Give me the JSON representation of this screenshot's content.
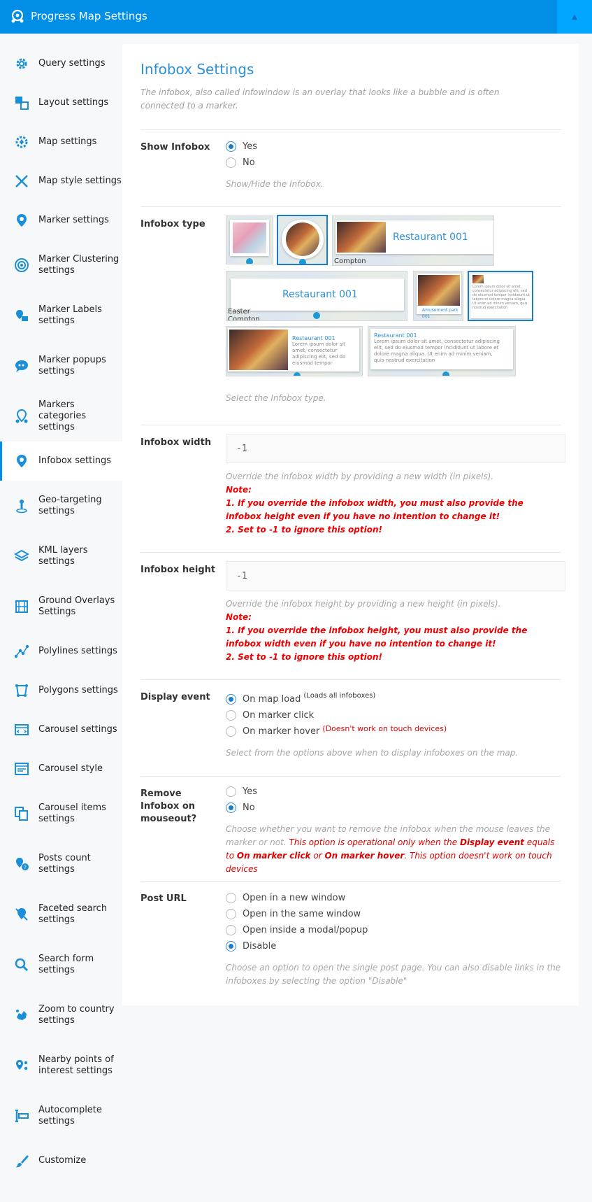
{
  "header": {
    "title": "Progress Map Settings",
    "collapse_icon": "▲"
  },
  "sidebar": {
    "items": [
      {
        "label": "Query settings",
        "icon": "gear-icon"
      },
      {
        "label": "Layout settings",
        "icon": "layout-icon"
      },
      {
        "label": "Map settings",
        "icon": "map-gear-icon"
      },
      {
        "label": "Map style settings",
        "icon": "brush-icon"
      },
      {
        "label": "Marker settings",
        "icon": "marker-icon"
      },
      {
        "label": "Marker Clustering settings",
        "icon": "cluster-icon"
      },
      {
        "label": "Marker Labels settings",
        "icon": "marker-label-icon"
      },
      {
        "label": "Marker popups settings",
        "icon": "popup-icon"
      },
      {
        "label": "Markers categories settings",
        "icon": "categories-icon"
      },
      {
        "label": "Infobox settings",
        "icon": "infobox-icon"
      },
      {
        "label": "Geo-targeting settings",
        "icon": "geo-target-icon"
      },
      {
        "label": "KML layers settings",
        "icon": "layers-icon"
      },
      {
        "label": "Ground Overlays Settings",
        "icon": "overlay-icon"
      },
      {
        "label": "Polylines settings",
        "icon": "polyline-icon"
      },
      {
        "label": "Polygons settings",
        "icon": "polygon-icon"
      },
      {
        "label": "Carousel settings",
        "icon": "carousel-icon"
      },
      {
        "label": "Carousel style",
        "icon": "carousel-style-icon"
      },
      {
        "label": "Carousel items settings",
        "icon": "carousel-items-icon"
      },
      {
        "label": "Posts count settings",
        "icon": "posts-count-icon"
      },
      {
        "label": "Faceted search settings",
        "icon": "faceted-search-icon"
      },
      {
        "label": "Search form settings",
        "icon": "search-icon"
      },
      {
        "label": "Zoom to country settings",
        "icon": "globe-icon"
      },
      {
        "label": "Nearby points of interest settings",
        "icon": "nearby-icon"
      },
      {
        "label": "Autocomplete settings",
        "icon": "autocomplete-icon"
      },
      {
        "label": "Customize",
        "icon": "customize-icon"
      }
    ]
  },
  "main": {
    "title": "Infobox Settings",
    "intro": "The infobox, also called infowindow is an overlay that looks like a bubble and is often connected to a marker.",
    "show_infobox": {
      "label": "Show Infobox",
      "options": [
        "Yes",
        "No"
      ],
      "selected": "Yes",
      "help": "Show/Hide the Infobox."
    },
    "infobox_type": {
      "label": "Infobox type",
      "thumb_title": "Restaurant 001",
      "thumb_small_title": "Restaurant 001",
      "thumb_town": "Compton",
      "thumb_town2": "Easter\nCompton",
      "thumb_park": "Amusement park 001",
      "thumb_lorem": "Lorem ipsum dolor sit amet, consectetur adipiscing elit, sed do eiusmod tempor incididunt",
      "thumb_lorem2": "Lorem ipsum dolor sit amet, consectetur adipiscing elit, sed do eiusmod tempor incididunt ut labore et dolore magna aliqua. Ut enim ad minim veniam, quis nostrud exercitation",
      "help": "Select the Infobox type."
    },
    "infobox_width": {
      "label": "Infobox width",
      "value": "-1",
      "help": "Override the infobox width by providing a new width (in pixels).",
      "note_title": "Note:",
      "note1": "1. If you override the infobox width, you must also provide the infobox height even if you have no intention to change it!",
      "note2": "2. Set to -1 to ignore this option!"
    },
    "infobox_height": {
      "label": "Infobox height",
      "value": "-1",
      "help": "Override the infobox height by providing a new height (in pixels).",
      "note_title": "Note:",
      "note1": "1. If you override the infobox height, you must also provide the infobox width even if you have no intention to change it!",
      "note2": "2. Set to -1 to ignore this option!"
    },
    "display_event": {
      "label": "Display event",
      "options": [
        "On map load",
        "On marker click",
        "On marker hover"
      ],
      "option1_sup": "(Loads all infoboxes)",
      "option3_warn": "(Doesn't work on touch devices)",
      "selected": "On map load",
      "help": "Select from the options above when to display infoboxes on the map."
    },
    "remove_infobox": {
      "label": "Remove Infobox on mouseout?",
      "options": [
        "Yes",
        "No"
      ],
      "selected": "No",
      "help_a": "Choose whether you want to remove the infobox when the mouse leaves the marker or not. ",
      "help_b": "This option is operational only when the ",
      "help_c": "Display event",
      "help_d": " equals to ",
      "help_e": "On marker click",
      "help_f": " or ",
      "help_g": "On marker hover",
      "help_h": ". This option doesn't work on touch devices"
    },
    "post_url": {
      "label": "Post URL",
      "options": [
        "Open in a new window",
        "Open in the same window",
        "Open inside a modal/popup",
        "Disable"
      ],
      "selected": "Disable",
      "help": "Choose an option to open the single post page. You can also disable links in the infoboxes by selecting the option \"Disable\""
    }
  },
  "colors": {
    "accent": "#008ee6",
    "title_blue": "#2d8fd6",
    "note_red": "#dd0000"
  }
}
